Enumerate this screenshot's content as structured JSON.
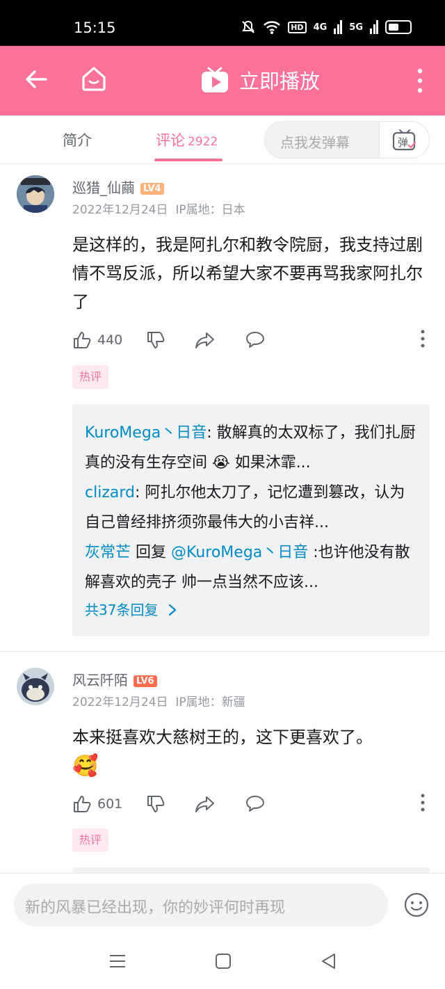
{
  "status_bar": {
    "time": "15:15",
    "network_labels": [
      "HD",
      "4G",
      "5G"
    ]
  },
  "top_bar": {
    "back_icon": "arrow-left-icon",
    "home_icon": "home-icon",
    "play_label": "立即播放",
    "more_icon": "more-vertical-icon",
    "bg_color": "#fb7299"
  },
  "tabs": {
    "intro_label": "简介",
    "comments_label": "评论",
    "comments_count": "2922",
    "danmaku_placeholder": "点我发弹幕",
    "danmaku_icon_text": "弹"
  },
  "comments": [
    {
      "username": "巡猎_仙繭",
      "level": "LV4",
      "level_color": "#ffb27a",
      "date": "2022年12月24日",
      "ip": "IP属地：日本",
      "content": "是这样的，我是阿扎尔和教令院厨，我支持过剧情不骂反派，所以希望大家不要再骂我家阿扎尔了",
      "likes": "440",
      "tag": "热评",
      "replies": [
        {
          "who": "KuroMega丶日音",
          "text": ": 散解真的太双标了，我们扎厨真的没有生存空间 😭 如果沐霏..."
        },
        {
          "who": "clizard",
          "text": ": 阿扎尔他太刀了，记忆遭到篡改，认为自己曾经排挤须弥最伟大的小吉祥..."
        },
        {
          "who": "灰常芒",
          "reply_word": " 回复 ",
          "target": "@KuroMega丶日音",
          "text": " :也许他没有散解喜欢的壳子 帅一点当然不应该..."
        }
      ],
      "replies_more": "共37条回复"
    },
    {
      "username": "风云阡陌",
      "level": "LV6",
      "level_color": "#ff6c4f",
      "date": "2022年12月24日",
      "ip": "IP属地：新疆",
      "content": "本来挺喜欢大慈树王的，这下更喜欢了。",
      "content_emoji": "🥰",
      "likes": "601",
      "tag": "热评"
    }
  ],
  "input_bar": {
    "placeholder": "新的风暴已经出现，你的妙评何时再现",
    "emoji_icon": "smile-face-icon"
  },
  "nav_bar": {
    "icons": [
      "menu-icon",
      "home-square-icon",
      "back-triangle-icon"
    ]
  }
}
